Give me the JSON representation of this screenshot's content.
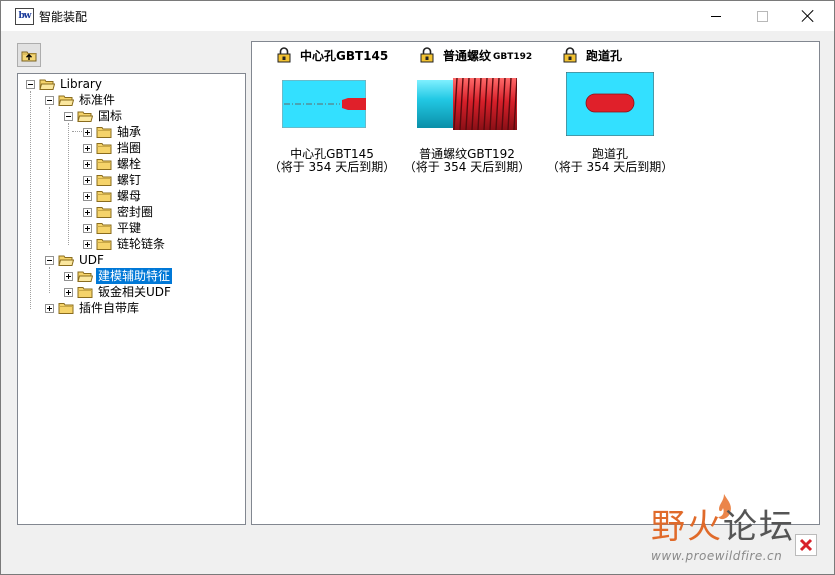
{
  "window": {
    "title": "智能装配",
    "app_icon_text": "bw"
  },
  "toolbar": {
    "up_button_icon": "folder-up-icon"
  },
  "tree": {
    "nodes": [
      {
        "label": "Library"
      },
      {
        "label": "标准件"
      },
      {
        "label": "国标"
      },
      {
        "label": "轴承"
      },
      {
        "label": "挡圈"
      },
      {
        "label": "螺栓"
      },
      {
        "label": "螺钉"
      },
      {
        "label": "螺母"
      },
      {
        "label": "密封圈"
      },
      {
        "label": "平键"
      },
      {
        "label": "链轮链条"
      },
      {
        "label": "UDF"
      },
      {
        "label": "建模辅助特征",
        "selected": true
      },
      {
        "label": "钣金相关UDF"
      },
      {
        "label": "插件自带库"
      }
    ]
  },
  "items": [
    {
      "title": "中心孔GBT145",
      "caption_line1": "中心孔GBT145",
      "caption_line2": "（将于 354 天后到期）",
      "icon": "lock-icon"
    },
    {
      "title": "普通螺纹",
      "title_suffix": "GBT192",
      "caption_line1": "普通螺纹GBT192",
      "caption_line2": "（将于 354 天后到期）",
      "icon": "lock-icon"
    },
    {
      "title": "跑道孔",
      "caption_line1": "跑道孔",
      "caption_line2": "（将于 354 天后到期）",
      "icon": "lock-icon"
    }
  ],
  "watermark": {
    "text_part1": "野火",
    "text_part2": "论坛",
    "url": "www.proewildfire.cn"
  },
  "colors": {
    "selection": "#0078d7",
    "thumb_cyan": "#33e0ff",
    "thumb_red": "#e0202a",
    "folder_yellow": "#f5d36a"
  }
}
